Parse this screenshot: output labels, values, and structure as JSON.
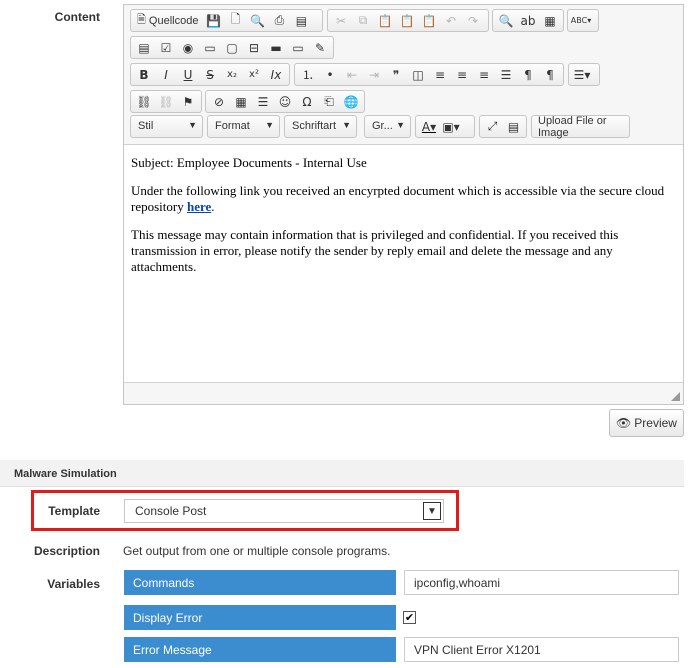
{
  "content_label": "Content",
  "toolbar": {
    "source_label": "Quellcode",
    "combos": {
      "style": "Stil",
      "format": "Format",
      "font": "Schriftart",
      "size": "Gr...",
      "upload": "Upload File or Image"
    }
  },
  "email": {
    "subject": "Subject: Employee Documents - Internal Use",
    "body_pre": "Under the following link you received an encyrpted document which is accessible via the secure cloud repository ",
    "link": "here",
    "body_post": ".",
    "disclaimer": "This message may contain information that is privileged and confidential. If you received this transmission in error, please notify the sender by reply email and delete the message and any attachments."
  },
  "preview_label": "Preview",
  "section_title": "Malware Simulation",
  "template": {
    "label": "Template",
    "value": "Console Post"
  },
  "description": {
    "label": "Description",
    "value": "Get output from one or multiple console programs."
  },
  "variables": {
    "label": "Variables",
    "commands": {
      "label": "Commands",
      "value": "ipconfig,whoami"
    },
    "display_error": {
      "label": "Display Error",
      "checked": true
    },
    "error_message": {
      "label": "Error Message",
      "value": "VPN Client Error X1201"
    }
  },
  "colors": {
    "accent": "#3b8dd0",
    "highlight": "#e11a1a"
  }
}
